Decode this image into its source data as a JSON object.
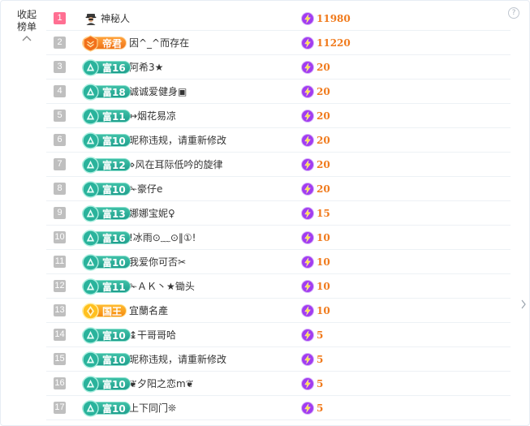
{
  "sidebar": {
    "collapse_label": "收起",
    "collapse_label_2": "榜单"
  },
  "help": {
    "label": "?"
  },
  "colors": {
    "rank_first": "#ff6f92",
    "rank_other": "#bfbfbf",
    "rich_badge": "#22a38f",
    "score": "#f07a1c",
    "bolt": "#8b2fe0"
  },
  "rows": [
    {
      "rank": "1",
      "badge_type": "avatar",
      "badge_icon": "incognito-avatar-icon",
      "badge_label": "",
      "nickname": "神秘人",
      "score": "11980"
    },
    {
      "rank": "2",
      "badge_type": "emperor",
      "badge_icon": "emperor-crest-icon",
      "badge_label": "帝君",
      "nickname": "因^_^而存在",
      "score": "11220"
    },
    {
      "rank": "3",
      "badge_type": "rich",
      "badge_icon": "rich-triangle-icon",
      "badge_label": "富16",
      "nickname": "阿希3★",
      "score": "20"
    },
    {
      "rank": "4",
      "badge_type": "rich",
      "badge_icon": "rich-triangle-icon",
      "badge_label": "富18",
      "nickname": "诚诚爱健身▣",
      "score": "20"
    },
    {
      "rank": "5",
      "badge_type": "rich",
      "badge_icon": "rich-triangle-icon",
      "badge_label": "富11",
      "nickname": "↔烟花易凉",
      "score": "20"
    },
    {
      "rank": "6",
      "badge_type": "rich",
      "badge_icon": "rich-triangle-icon",
      "badge_label": "富10",
      "nickname": "昵称违规，请重新修改",
      "score": "20"
    },
    {
      "rank": "7",
      "badge_type": "rich",
      "badge_icon": "rich-triangle-icon",
      "badge_label": "富12",
      "nickname": "⋄风在耳际低吟的旋律",
      "score": "20"
    },
    {
      "rank": "8",
      "badge_type": "rich",
      "badge_icon": "rich-triangle-icon",
      "badge_label": "富10",
      "nickname": "✁豪仔e",
      "score": "20"
    },
    {
      "rank": "9",
      "badge_type": "rich",
      "badge_icon": "rich-triangle-icon",
      "badge_label": "富13",
      "nickname": "娜娜宝妮♀",
      "score": "15"
    },
    {
      "rank": "10",
      "badge_type": "rich",
      "badge_icon": "rich-triangle-icon",
      "badge_label": "富16",
      "nickname": "!冰雨⊙﹏⊙‖①!",
      "score": "10"
    },
    {
      "rank": "11",
      "badge_type": "rich",
      "badge_icon": "rich-triangle-icon",
      "badge_label": "富10",
      "nickname": "我爱你可否✂",
      "score": "10"
    },
    {
      "rank": "12",
      "badge_type": "rich",
      "badge_icon": "rich-triangle-icon",
      "badge_label": "富11",
      "nickname": "✁ＡＫ丶★锄头",
      "score": "10"
    },
    {
      "rank": "13",
      "badge_type": "king",
      "badge_icon": "king-crest-icon",
      "badge_label": "国王",
      "nickname": "宜蘭名產",
      "score": "10"
    },
    {
      "rank": "14",
      "badge_type": "rich",
      "badge_icon": "rich-triangle-icon",
      "badge_label": "富10",
      "nickname": "↨干哥哥哈",
      "score": "5"
    },
    {
      "rank": "15",
      "badge_type": "rich",
      "badge_icon": "rich-triangle-icon",
      "badge_label": "富10",
      "nickname": "昵称违规，请重新修改",
      "score": "5"
    },
    {
      "rank": "16",
      "badge_type": "rich",
      "badge_icon": "rich-triangle-icon",
      "badge_label": "富10",
      "nickname": "❦夕阳之恋m❦",
      "score": "5"
    },
    {
      "rank": "17",
      "badge_type": "rich",
      "badge_icon": "rich-triangle-icon",
      "badge_label": "富10",
      "nickname": "上下同门❊",
      "score": "5"
    }
  ]
}
